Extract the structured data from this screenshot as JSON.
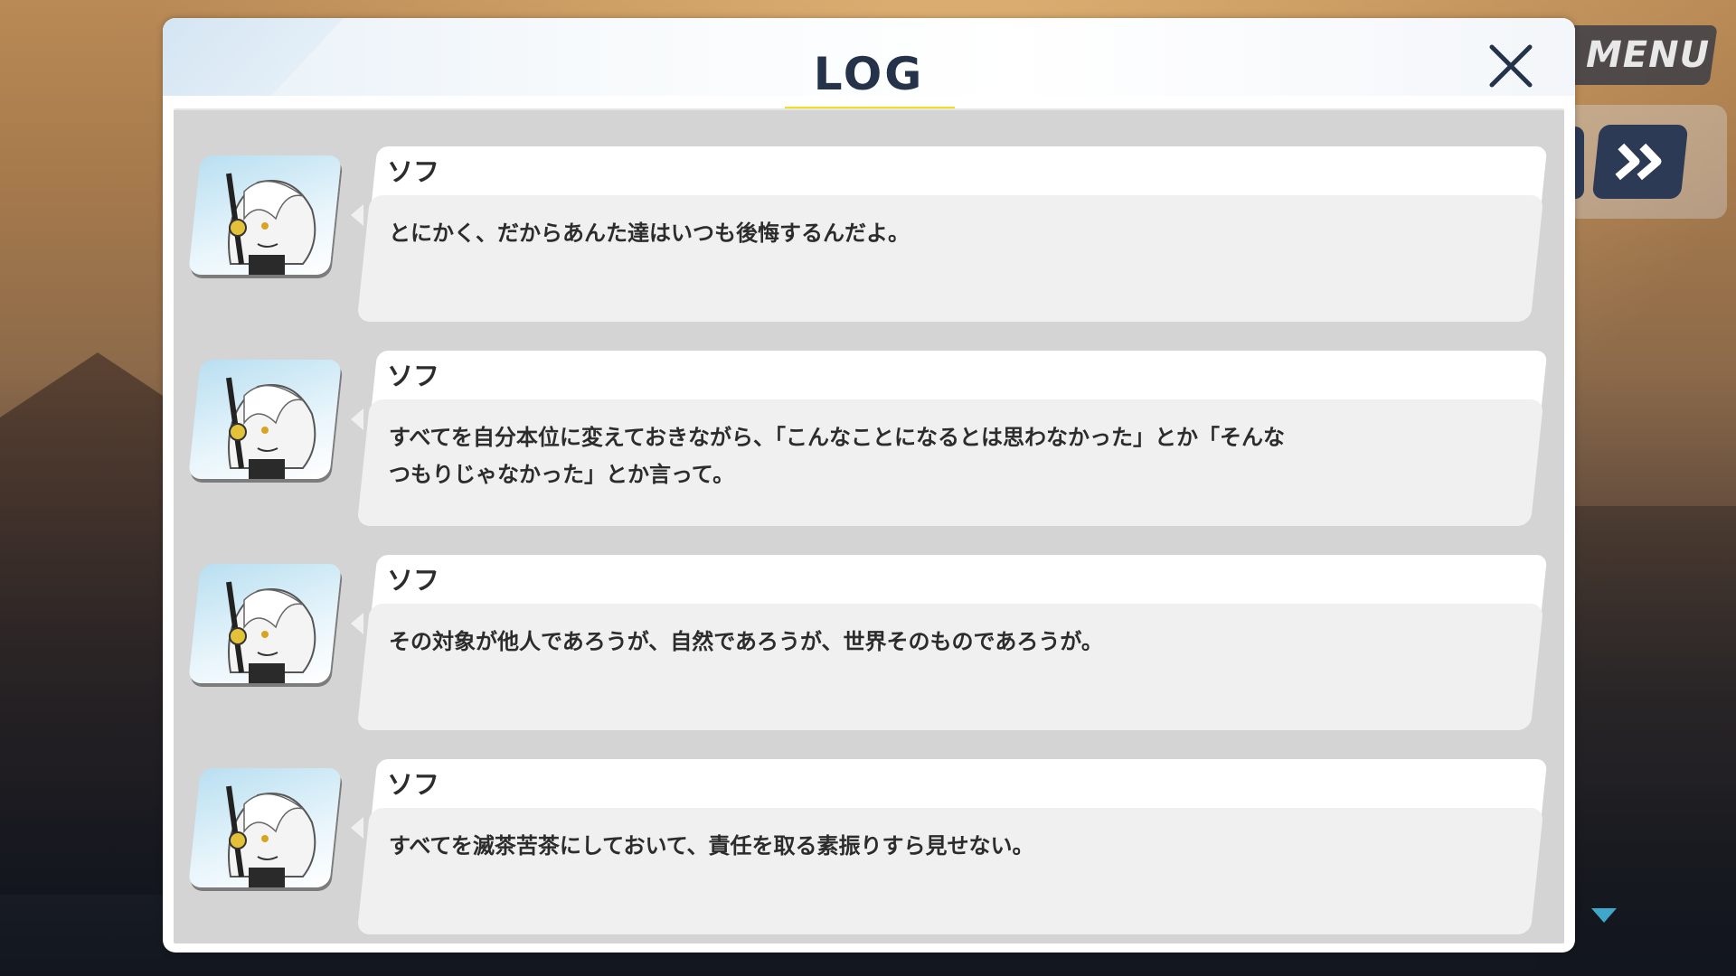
{
  "header": {
    "title": "LOG",
    "close_icon": "close-icon"
  },
  "hud": {
    "menu_label": "MENU",
    "fast_forward_icon": "fast-forward-icon",
    "scroll_indicator_icon": "triangle-down-icon"
  },
  "colors": {
    "title": "#24324a",
    "underline": "#f2df23",
    "button_navy": "#2c3a55",
    "scroll_arrow": "#3fa7c9"
  },
  "log": {
    "entries": [
      {
        "speaker": "ソフ",
        "text": "とにかく、だからあんた達はいつも後悔するんだよ。"
      },
      {
        "speaker": "ソフ",
        "text": "すべてを自分本位に変えておきながら、「こんなことになるとは思わなかった」とか「そんな\nつもりじゃなかった」とか言って。"
      },
      {
        "speaker": "ソフ",
        "text": "その対象が他人であろうが、自然であろうが、世界そのものであろうが。"
      },
      {
        "speaker": "ソフ",
        "text": "すべてを滅茶苦茶にしておいて、責任を取る素振りすら見せない。"
      }
    ]
  }
}
